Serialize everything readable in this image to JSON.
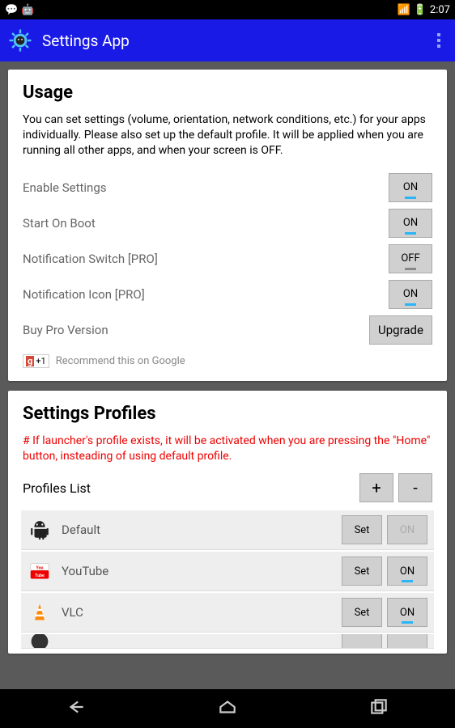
{
  "status": {
    "time": "2:07"
  },
  "header": {
    "title": "Settings App"
  },
  "usage": {
    "heading": "Usage",
    "description": "You can set settings (volume, orientation, network conditions, etc.) for your apps individually. Please also set up the default profile. It will be applied when you are running all other apps, and when your screen is OFF.",
    "rows": [
      {
        "label": "Enable Settings",
        "button": "ON",
        "state": "on"
      },
      {
        "label": "Start On Boot",
        "button": "ON",
        "state": "on"
      },
      {
        "label": "Notification Switch [PRO]",
        "button": "OFF",
        "state": "off"
      },
      {
        "label": "Notification Icon [PRO]",
        "button": "ON",
        "state": "on"
      },
      {
        "label": "Buy Pro Version",
        "button": "Upgrade",
        "state": "upgrade"
      }
    ],
    "gplus_badge": "+1",
    "gplus_text": "Recommend this on Google"
  },
  "profiles": {
    "heading": "Settings Profiles",
    "warning": "# If launcher's profile exists, it will be activated when you are pressing the \"Home\" button, insteading of using default profile.",
    "list_label": "Profiles List",
    "add": "+",
    "remove": "-",
    "items": [
      {
        "name": "Default",
        "set": "Set",
        "toggle": "ON",
        "toggle_state": "disabled",
        "icon": "android"
      },
      {
        "name": "YouTube",
        "set": "Set",
        "toggle": "ON",
        "toggle_state": "on",
        "icon": "youtube"
      },
      {
        "name": "VLC",
        "set": "Set",
        "toggle": "ON",
        "toggle_state": "on",
        "icon": "vlc"
      }
    ]
  }
}
